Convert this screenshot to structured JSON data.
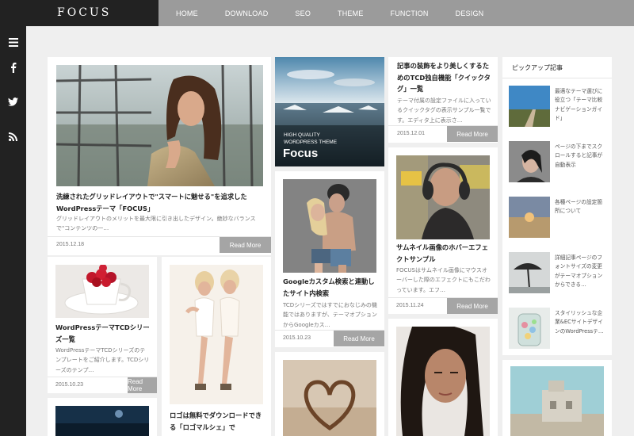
{
  "logo": "FOCUS",
  "nav": [
    "HOME",
    "DOWNLOAD",
    "SEO",
    "THEME",
    "FUNCTION",
    "DESIGN"
  ],
  "sidebar_icons": [
    {
      "name": "menu-icon",
      "glyph": "☰"
    },
    {
      "name": "facebook-icon",
      "glyph": "f"
    },
    {
      "name": "twitter-icon",
      "glyph": "t"
    },
    {
      "name": "rss-icon",
      "glyph": "◔"
    }
  ],
  "more_label": "Read More",
  "posts": {
    "p1": {
      "title": "洗練されたグリッドレイアウトで\"スマートに魅せる\"を追求したWordPressテーマ「FOCUS」",
      "excerpt": "グリッドレイアウトのメリットを最大限に引き出したデザイン。絶妙なバランスで\"コンテンツの一…",
      "date": "2015.12.18"
    },
    "p2": {
      "banner_line1": "HIGH QUALITY",
      "banner_line2": "WORDPRESS THEME",
      "banner_title": "Focus"
    },
    "p3": {
      "title": "記事の装飾をより美しくするためのTCD独自機能「クイックタグ」一覧",
      "excerpt": "テーマ付属の設定ファイルに入っているクイックタグの表示サンプル一覧です。エディタ上に表示さ…",
      "date": "2015.12.01"
    },
    "p4": {
      "title": "Googleカスタム検索と連動したサイト内検索",
      "excerpt": "TCDシリーズではすでにおなじみの機能ではありますが、テーマオプションからGoogleカス…",
      "date": "2015.10.23"
    },
    "p5": {
      "title": "サムネイル画像のホバーエフェクトサンプル",
      "excerpt": "FOCUSはサムネイル画像にマウスオーバーした際のエフェクトにもこだわっています。エフ…",
      "date": "2015.11.24"
    },
    "p6": {
      "title": "WordPressテーマTCDシリーズ一覧",
      "excerpt": "WordPressテーマTCDシリーズのテンプレートをご紹介します。TCDシリーズのテンプ…",
      "date": "2015.10.23"
    },
    "p7": {
      "title": "ロゴは無料でダウンロードできる「ロゴマルシェ」で"
    }
  },
  "pickup": {
    "title": "ピックアップ記事",
    "items": [
      "最適なテーマ選びに役立つ「テーマ比較ナビゲーションガイド」",
      "ページの下までスクロールすると記事が自動表示",
      "各種ページの設定箇所について",
      "詳細記事ページのフォントサイズの変更がテーマオプションからできる…",
      "スタイリッシュな企業&ECサイトデザインのWordPressテ…"
    ]
  }
}
